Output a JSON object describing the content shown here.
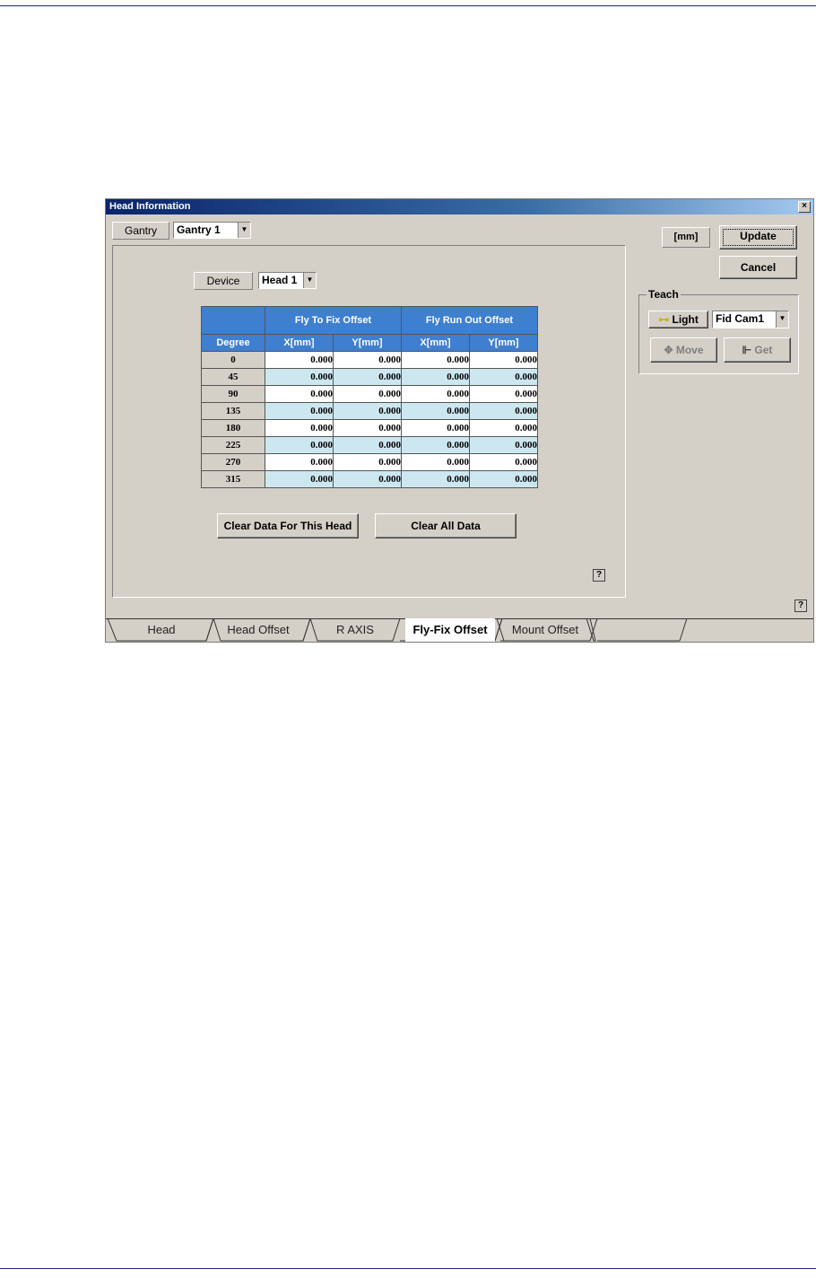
{
  "window": {
    "title": "Head Information",
    "close_glyph": "×"
  },
  "gantry": {
    "label": "Gantry",
    "value": "Gantry 1"
  },
  "device": {
    "label": "Device",
    "value": "Head 1"
  },
  "unit_label": "[mm]",
  "buttons": {
    "update": "Update",
    "cancel": "Cancel",
    "clear_head": "Clear Data For This Head",
    "clear_all": "Clear All Data"
  },
  "teach": {
    "title": "Teach",
    "light": "Light",
    "camera": "Fid Cam1",
    "move": "Move",
    "get": "Get"
  },
  "help_glyph": "?",
  "table": {
    "group_headers": [
      "Fly To Fix Offset",
      "Fly Run Out Offset"
    ],
    "col_headers": [
      "Degree",
      "X[mm]",
      "Y[mm]",
      "X[mm]",
      "Y[mm]"
    ],
    "rows": [
      [
        "0",
        "0.000",
        "0.000",
        "0.000",
        "0.000"
      ],
      [
        "45",
        "0.000",
        "0.000",
        "0.000",
        "0.000"
      ],
      [
        "90",
        "0.000",
        "0.000",
        "0.000",
        "0.000"
      ],
      [
        "135",
        "0.000",
        "0.000",
        "0.000",
        "0.000"
      ],
      [
        "180",
        "0.000",
        "0.000",
        "0.000",
        "0.000"
      ],
      [
        "225",
        "0.000",
        "0.000",
        "0.000",
        "0.000"
      ],
      [
        "270",
        "0.000",
        "0.000",
        "0.000",
        "0.000"
      ],
      [
        "315",
        "0.000",
        "0.000",
        "0.000",
        "0.000"
      ]
    ]
  },
  "tabs": [
    "Head",
    "Head Offset",
    "R AXIS",
    "Fly-Fix Offset",
    "Mount Offset"
  ],
  "active_tab": "Fly-Fix Offset"
}
